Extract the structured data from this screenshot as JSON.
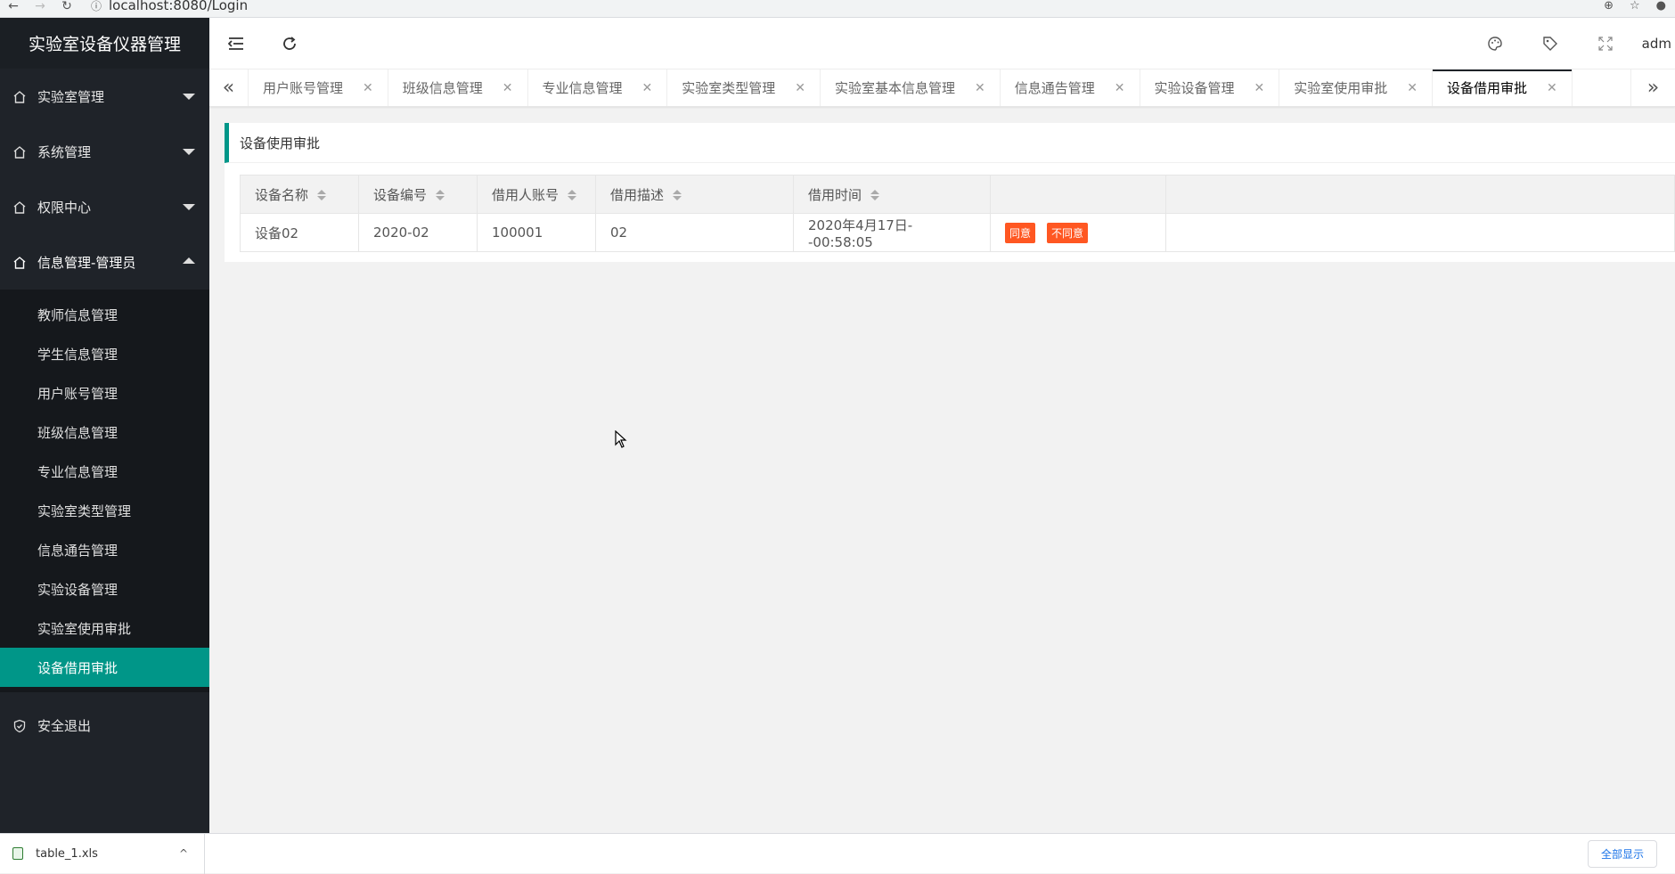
{
  "browser": {
    "url": "localhost:8080/Login"
  },
  "sidebar": {
    "app_title": "实验室设备仪器管理",
    "groups": [
      {
        "label": "实验室管理"
      },
      {
        "label": "系统管理"
      },
      {
        "label": "权限中心"
      },
      {
        "label": "信息管理-管理员"
      }
    ],
    "submenu": [
      {
        "label": "教师信息管理"
      },
      {
        "label": "学生信息管理"
      },
      {
        "label": "用户账号管理"
      },
      {
        "label": "班级信息管理"
      },
      {
        "label": "专业信息管理"
      },
      {
        "label": "实验室类型管理"
      },
      {
        "label": "信息通告管理"
      },
      {
        "label": "实验设备管理"
      },
      {
        "label": "实验室使用审批"
      },
      {
        "label": "设备借用审批"
      }
    ],
    "logout": "安全退出"
  },
  "header": {
    "user": "adm"
  },
  "tabs": [
    {
      "label": "用户账号管理"
    },
    {
      "label": "班级信息管理"
    },
    {
      "label": "专业信息管理"
    },
    {
      "label": "实验室类型管理"
    },
    {
      "label": "实验室基本信息管理"
    },
    {
      "label": "信息通告管理"
    },
    {
      "label": "实验设备管理"
    },
    {
      "label": "实验室使用审批"
    },
    {
      "label": "设备借用审批"
    }
  ],
  "content": {
    "title": "设备使用审批",
    "columns": [
      "设备名称",
      "设备编号",
      "借用人账号",
      "借用描述",
      "借用时间"
    ],
    "rows": [
      {
        "name": "设备02",
        "code": "2020-02",
        "account": "100001",
        "desc": "02",
        "time": "2020年4月17日--00:58:05"
      }
    ],
    "approve_label": "同意",
    "reject_label": "不同意"
  },
  "downloads": {
    "file": "table_1.xls",
    "show_all": "全部显示"
  }
}
